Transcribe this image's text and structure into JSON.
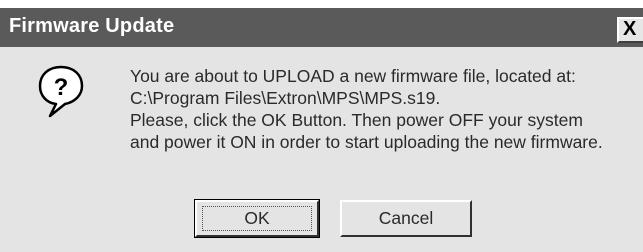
{
  "window": {
    "title": "Firmware Update",
    "close_label": "X"
  },
  "icon": {
    "name": "question-icon",
    "glyph": "?"
  },
  "message": {
    "lines": [
      "You are about to UPLOAD a new firmware file, located at:",
      "C:\\Program Files\\Extron\\MPS\\MPS.s19.",
      "Please, click the OK Button. Then power OFF your system",
      "and power it ON in order to start uploading the new firmware."
    ]
  },
  "buttons": {
    "ok_label": "OK",
    "cancel_label": "Cancel"
  },
  "colors": {
    "titlebar": "#5a5a5a",
    "dialog_bg": "#e4e4e4"
  }
}
